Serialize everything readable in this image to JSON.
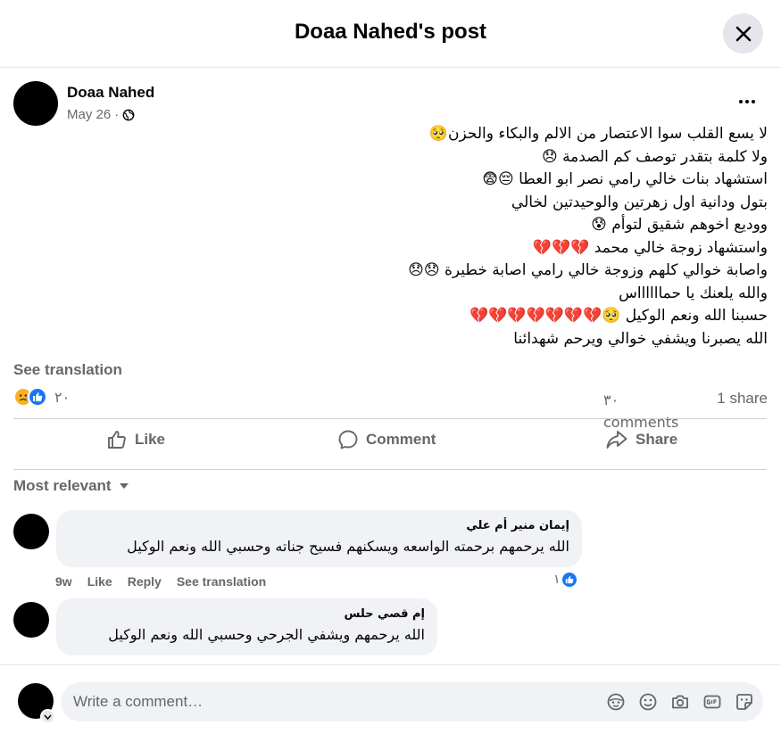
{
  "header": {
    "title": "Doaa Nahed's post"
  },
  "post": {
    "author": "Doaa Nahed",
    "date": "May 26",
    "separator": "·",
    "lines": [
      "لا يسع القلب سوا الاعتصار من الالم والبكاء والحزن🥺",
      "ولا كلمة بتقدر توصف كم الصدمة 😞",
      "استشهاد بنات خالي رامي نصر ابو العطا 😔😨",
      "بتول ودانية اول زهرتين والوحيدتين لخالي",
      "ووديع اخوهم شقيق لتوأم 😰",
      "واستشهاد زوجة خالي محمد 💔💔💔",
      "واصابة خوالي كلهم وزوجة خالي رامي اصابة خطيرة 😞😞",
      "والله يلعنك يا حمااااااس",
      "حسبنا الله ونعم الوكيل 🥺💔💔💔💔💔💔💔",
      "الله يصبرنا ويشفي خوالي ويرحم شهدائنا"
    ],
    "see_translation": "See translation",
    "reaction_count": "٢٠",
    "comments_count": "٣٠ comments",
    "shares_count": "1 share"
  },
  "actions": {
    "like": "Like",
    "comment": "Comment",
    "share": "Share"
  },
  "sort_label": "Most relevant",
  "comments": [
    {
      "name": "إيمان منير أم علي",
      "text": "الله يرحمهم برحمته الواسعه ويسكنهم فسيح جناته وحسبي الله ونعم الوكيل",
      "time": "9w",
      "like": "Like",
      "reply": "Reply",
      "translate": "See translation",
      "likes": "١"
    },
    {
      "name": "إم قصي حلس",
      "text": "الله يرحمهم ويشفي الجرحي وحسبي الله ونعم الوكيل"
    }
  ],
  "composer": {
    "placeholder": "Write a comment…"
  },
  "colors": {
    "accent": "#1877f2",
    "secondary_text": "#65676b",
    "bubble": "#f0f2f5"
  }
}
